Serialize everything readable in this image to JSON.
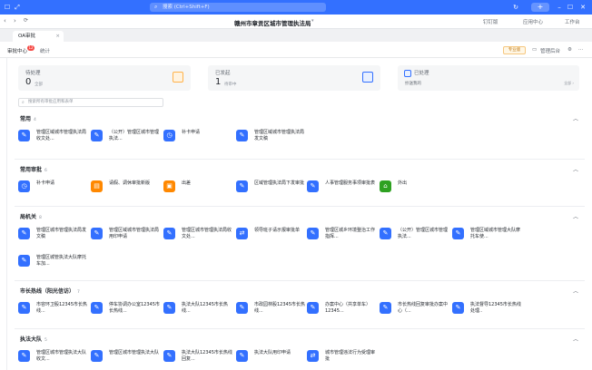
{
  "topbar": {
    "search_placeholder": "搜索 (Ctrl+Shift+F)",
    "colors": {
      "topbar": "#3370ff"
    }
  },
  "titlebar": {
    "title": "赣州市章贡区城市管理执法局",
    "right_items": [
      "钉钉版",
      "应用中心",
      "工作台"
    ]
  },
  "tab": {
    "label": "OA审批"
  },
  "subnav": {
    "items": [
      "审批中心",
      "统计"
    ],
    "badge": "12",
    "project_label": "专业版",
    "manage_label": "管理后台"
  },
  "cards": [
    {
      "label": "待处理",
      "value": "0",
      "unit": "全部"
    },
    {
      "label": "已发起",
      "value": "1",
      "unit": "待审中"
    },
    {
      "label": "已处理",
      "sub": "抄送我的",
      "sub_right": "全部 ›"
    }
  ],
  "search": {
    "placeholder": "搜索所有审批应用和表单"
  },
  "sections": [
    {
      "title": "常用",
      "count": "4",
      "apps": [
        {
          "name": "管理区域城市管理执法局收文处...",
          "icon": "doc-icon",
          "color": "#3370ff"
        },
        {
          "name": "（公开）管理区城市管理执法...",
          "icon": "doc-icon",
          "color": "#3370ff"
        },
        {
          "name": "补卡申请",
          "icon": "clock-icon",
          "color": "#3370ff"
        },
        {
          "name": "管理区域城市管理执法局发文稿",
          "icon": "doc-icon",
          "color": "#3370ff"
        }
      ]
    },
    {
      "title": "常用审批",
      "count": "6",
      "apps": [
        {
          "name": "补卡申请",
          "icon": "clock-icon",
          "color": "#3370ff"
        },
        {
          "name": "请假、调休审批新版",
          "icon": "calendar-icon",
          "color": "#ff8800"
        },
        {
          "name": "出差",
          "icon": "briefcase-icon",
          "color": "#ff8800"
        },
        {
          "name": "区域管理执法局下发审批",
          "icon": "doc-icon",
          "color": "#3370ff"
        },
        {
          "name": "人事管理服务事项审批表",
          "icon": "doc-icon",
          "color": "#3370ff"
        },
        {
          "name": "外出",
          "icon": "building-icon",
          "color": "#2ea121"
        }
      ]
    },
    {
      "title": "局机关",
      "count": "8",
      "apps": [
        {
          "name": "管理区城市管理执法局发文稿",
          "icon": "doc-icon",
          "color": "#3370ff"
        },
        {
          "name": "管理区域城市管理执法局用印申请",
          "icon": "doc-icon",
          "color": "#3370ff"
        },
        {
          "name": "管理区城市管理执法局收文处...",
          "icon": "doc-icon",
          "color": "#3370ff"
        },
        {
          "name": "领导班子请示报审批单",
          "icon": "share-icon",
          "color": "#3370ff"
        },
        {
          "name": "管理区城乡环境整治工作指挥...",
          "icon": "doc-icon",
          "color": "#3370ff"
        },
        {
          "name": "（公开）管理区城市管理执法...",
          "icon": "doc-icon",
          "color": "#3370ff"
        },
        {
          "name": "管理区域城市管理大队摩托车使...",
          "icon": "doc-icon",
          "color": "#3370ff"
        },
        {
          "name": "管理区城管执法大队摩托车加...",
          "icon": "doc-icon",
          "color": "#3370ff"
        }
      ]
    },
    {
      "title": "市长热线（阳光信访）",
      "count": "7",
      "apps": [
        {
          "name": "市容环卫股12345市长热线...",
          "icon": "doc-icon",
          "color": "#3370ff"
        },
        {
          "name": "停车协调办公室12345市长热线...",
          "icon": "doc-icon",
          "color": "#3370ff"
        },
        {
          "name": "执法大队12345市长热线...",
          "icon": "doc-icon",
          "color": "#3370ff"
        },
        {
          "name": "市政园林股12345市长热线...",
          "icon": "doc-icon",
          "color": "#3370ff"
        },
        {
          "name": "办案中心（共享单车）12345...",
          "icon": "doc-icon",
          "color": "#3370ff"
        },
        {
          "name": "市长热线回复审批办案中心（...",
          "icon": "doc-icon",
          "color": "#3370ff"
        },
        {
          "name": "执法督导12345市长热线处理..",
          "icon": "doc-icon",
          "color": "#3370ff"
        }
      ]
    },
    {
      "title": "执法大队",
      "count": "5",
      "apps": [
        {
          "name": "管理区城市管理执法大队收文...",
          "icon": "doc-icon",
          "color": "#3370ff"
        },
        {
          "name": "管理区城市管理执法大队",
          "icon": "doc-icon",
          "color": "#3370ff"
        },
        {
          "name": "执法大队12345市长热线回复...",
          "icon": "doc-icon",
          "color": "#3370ff"
        },
        {
          "name": "执法大队用印申请",
          "icon": "doc-icon",
          "color": "#3370ff"
        },
        {
          "name": "城市管理违法行为受理审批",
          "icon": "share-icon",
          "color": "#3370ff"
        }
      ]
    }
  ]
}
